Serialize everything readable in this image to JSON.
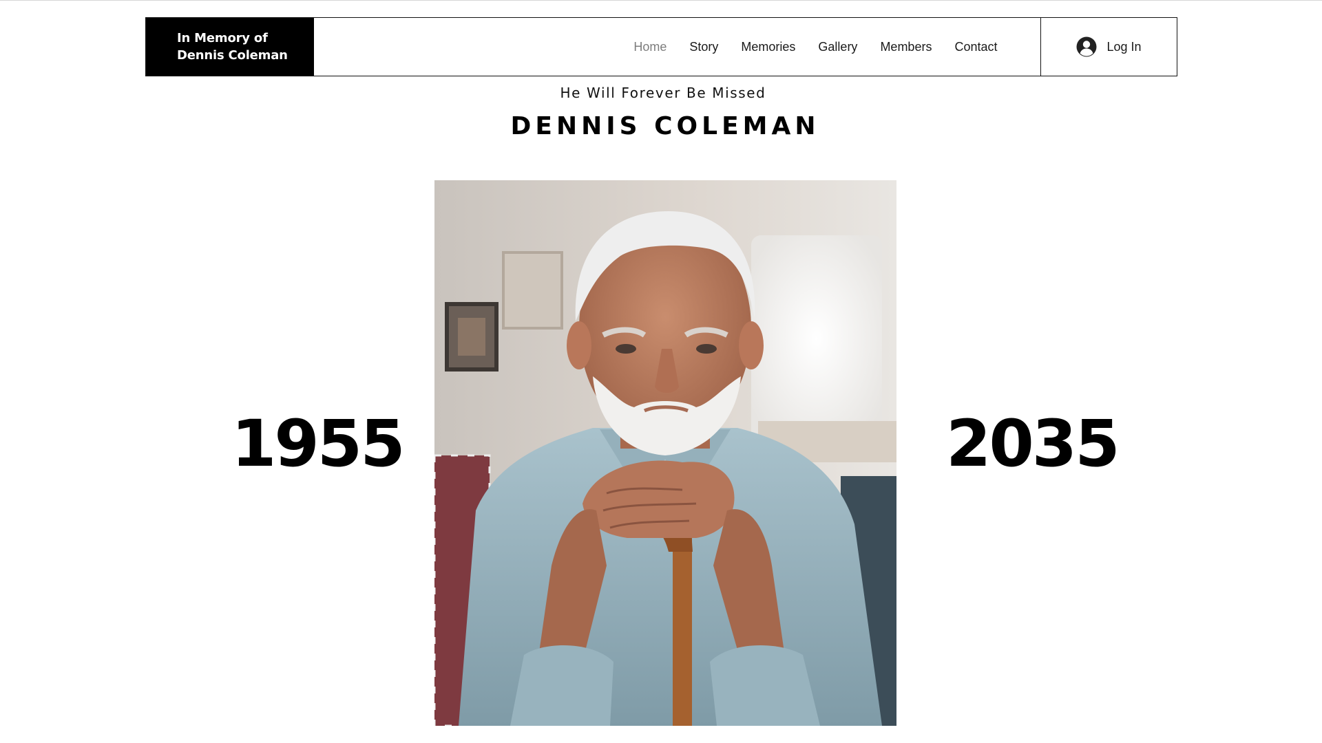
{
  "header": {
    "brand_line1": "In Memory of",
    "brand_line2": "Dennis Coleman",
    "nav": [
      {
        "label": "Home",
        "active": true
      },
      {
        "label": "Story",
        "active": false
      },
      {
        "label": "Memories",
        "active": false
      },
      {
        "label": "Gallery",
        "active": false
      },
      {
        "label": "Members",
        "active": false
      },
      {
        "label": "Contact",
        "active": false
      }
    ],
    "login_label": "Log In",
    "login_icon": "user-avatar-icon"
  },
  "hero": {
    "tagline": "He Will Forever Be Missed",
    "name": "DENNIS COLEMAN",
    "birth_year": "1955",
    "death_year": "2035",
    "portrait": "portrait-photo"
  },
  "colors": {
    "brand_bg": "#000000",
    "active_nav": "#7d7d7d",
    "text": "#1a1a1a"
  }
}
